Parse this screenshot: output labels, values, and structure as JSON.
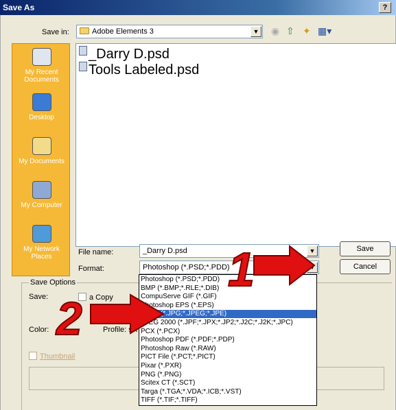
{
  "window": {
    "title": "Save As",
    "help_label": "?|X"
  },
  "toolbar": {
    "save_in_label": "Save in:",
    "save_in_value": "Adobe Elements 3",
    "back_icon": "back-arrow-icon",
    "up_icon": "up-folder-icon",
    "new_folder_icon": "new-folder-icon",
    "views_icon": "views-menu-icon"
  },
  "places": [
    {
      "label": "My Recent Documents",
      "icon": "recent-documents-icon"
    },
    {
      "label": "Desktop",
      "icon": "desktop-icon"
    },
    {
      "label": "My Documents",
      "icon": "my-documents-icon"
    },
    {
      "label": "My Computer",
      "icon": "my-computer-icon"
    },
    {
      "label": "My Network Places",
      "icon": "network-places-icon"
    }
  ],
  "files": [
    "_Darry D.psd",
    "Tools Labeled.psd"
  ],
  "form": {
    "file_name_label": "File name:",
    "file_name_value": "_Darry D.psd",
    "format_label": "Format:",
    "format_value": "Photoshop (*.PSD;*.PDD)",
    "save_button": "Save",
    "cancel_button": "Cancel"
  },
  "save_options": {
    "group_label": "Save Options",
    "save_label": "Save:",
    "as_copy_label": "a Copy",
    "color_label": "Color:",
    "profile_label": "Profile: sR",
    "thumbnail_label": "Thumbnail"
  },
  "format_options": [
    "Photoshop (*.PSD;*.PDD)",
    "BMP (*.BMP;*.RLE;*.DIB)",
    "CompuServe GIF (*.GIF)",
    "Photoshop EPS (*.EPS)",
    "JPEG (*.JPG;*.JPEG;*.JPE)",
    "JPEG 2000 (*.JPF;*.JPX;*.JP2;*.J2C;*.J2K;*.JPC)",
    "PCX (*.PCX)",
    "Photoshop PDF (*.PDF;*.PDP)",
    "Photoshop Raw (*.RAW)",
    "PICT File (*.PCT;*.PICT)",
    "Pixar (*.PXR)",
    "PNG (*.PNG)",
    "Scitex CT (*.SCT)",
    "Targa (*.TGA;*.VDA;*.ICB;*.VST)",
    "TIFF (*.TIF;*.TIFF)"
  ],
  "selected_format_index": 4,
  "callouts": [
    "1",
    "2"
  ],
  "colors": {
    "places_bg": "#f5b937",
    "selection": "#316ac5",
    "callout_red": "#e01010",
    "dialog_bg": "#ece9d8"
  }
}
